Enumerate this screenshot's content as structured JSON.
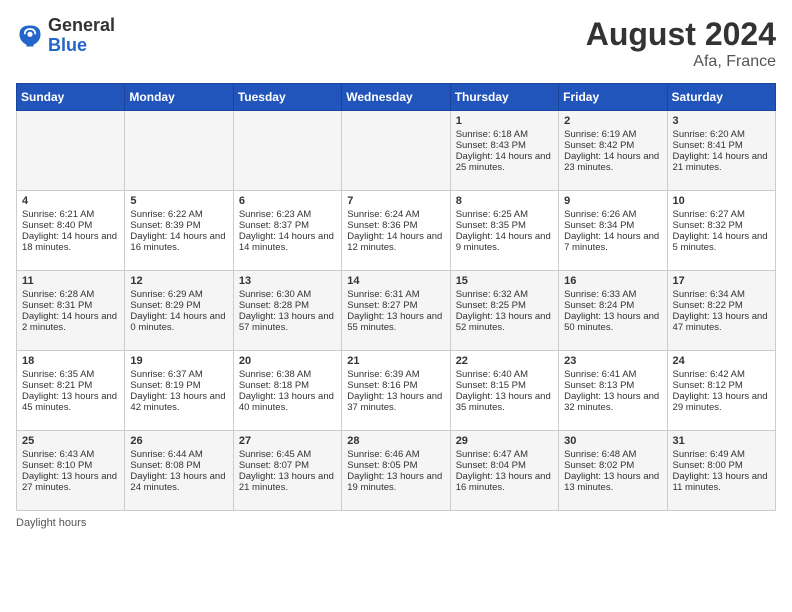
{
  "logo": {
    "general": "General",
    "blue": "Blue"
  },
  "title": "August 2024",
  "location": "Afa, France",
  "days_header": [
    "Sunday",
    "Monday",
    "Tuesday",
    "Wednesday",
    "Thursday",
    "Friday",
    "Saturday"
  ],
  "weeks": [
    [
      {
        "day": "",
        "info": ""
      },
      {
        "day": "",
        "info": ""
      },
      {
        "day": "",
        "info": ""
      },
      {
        "day": "",
        "info": ""
      },
      {
        "day": "1",
        "info": "Sunrise: 6:18 AM\nSunset: 8:43 PM\nDaylight: 14 hours and 25 minutes."
      },
      {
        "day": "2",
        "info": "Sunrise: 6:19 AM\nSunset: 8:42 PM\nDaylight: 14 hours and 23 minutes."
      },
      {
        "day": "3",
        "info": "Sunrise: 6:20 AM\nSunset: 8:41 PM\nDaylight: 14 hours and 21 minutes."
      }
    ],
    [
      {
        "day": "4",
        "info": "Sunrise: 6:21 AM\nSunset: 8:40 PM\nDaylight: 14 hours and 18 minutes."
      },
      {
        "day": "5",
        "info": "Sunrise: 6:22 AM\nSunset: 8:39 PM\nDaylight: 14 hours and 16 minutes."
      },
      {
        "day": "6",
        "info": "Sunrise: 6:23 AM\nSunset: 8:37 PM\nDaylight: 14 hours and 14 minutes."
      },
      {
        "day": "7",
        "info": "Sunrise: 6:24 AM\nSunset: 8:36 PM\nDaylight: 14 hours and 12 minutes."
      },
      {
        "day": "8",
        "info": "Sunrise: 6:25 AM\nSunset: 8:35 PM\nDaylight: 14 hours and 9 minutes."
      },
      {
        "day": "9",
        "info": "Sunrise: 6:26 AM\nSunset: 8:34 PM\nDaylight: 14 hours and 7 minutes."
      },
      {
        "day": "10",
        "info": "Sunrise: 6:27 AM\nSunset: 8:32 PM\nDaylight: 14 hours and 5 minutes."
      }
    ],
    [
      {
        "day": "11",
        "info": "Sunrise: 6:28 AM\nSunset: 8:31 PM\nDaylight: 14 hours and 2 minutes."
      },
      {
        "day": "12",
        "info": "Sunrise: 6:29 AM\nSunset: 8:29 PM\nDaylight: 14 hours and 0 minutes."
      },
      {
        "day": "13",
        "info": "Sunrise: 6:30 AM\nSunset: 8:28 PM\nDaylight: 13 hours and 57 minutes."
      },
      {
        "day": "14",
        "info": "Sunrise: 6:31 AM\nSunset: 8:27 PM\nDaylight: 13 hours and 55 minutes."
      },
      {
        "day": "15",
        "info": "Sunrise: 6:32 AM\nSunset: 8:25 PM\nDaylight: 13 hours and 52 minutes."
      },
      {
        "day": "16",
        "info": "Sunrise: 6:33 AM\nSunset: 8:24 PM\nDaylight: 13 hours and 50 minutes."
      },
      {
        "day": "17",
        "info": "Sunrise: 6:34 AM\nSunset: 8:22 PM\nDaylight: 13 hours and 47 minutes."
      }
    ],
    [
      {
        "day": "18",
        "info": "Sunrise: 6:35 AM\nSunset: 8:21 PM\nDaylight: 13 hours and 45 minutes."
      },
      {
        "day": "19",
        "info": "Sunrise: 6:37 AM\nSunset: 8:19 PM\nDaylight: 13 hours and 42 minutes."
      },
      {
        "day": "20",
        "info": "Sunrise: 6:38 AM\nSunset: 8:18 PM\nDaylight: 13 hours and 40 minutes."
      },
      {
        "day": "21",
        "info": "Sunrise: 6:39 AM\nSunset: 8:16 PM\nDaylight: 13 hours and 37 minutes."
      },
      {
        "day": "22",
        "info": "Sunrise: 6:40 AM\nSunset: 8:15 PM\nDaylight: 13 hours and 35 minutes."
      },
      {
        "day": "23",
        "info": "Sunrise: 6:41 AM\nSunset: 8:13 PM\nDaylight: 13 hours and 32 minutes."
      },
      {
        "day": "24",
        "info": "Sunrise: 6:42 AM\nSunset: 8:12 PM\nDaylight: 13 hours and 29 minutes."
      }
    ],
    [
      {
        "day": "25",
        "info": "Sunrise: 6:43 AM\nSunset: 8:10 PM\nDaylight: 13 hours and 27 minutes."
      },
      {
        "day": "26",
        "info": "Sunrise: 6:44 AM\nSunset: 8:08 PM\nDaylight: 13 hours and 24 minutes."
      },
      {
        "day": "27",
        "info": "Sunrise: 6:45 AM\nSunset: 8:07 PM\nDaylight: 13 hours and 21 minutes."
      },
      {
        "day": "28",
        "info": "Sunrise: 6:46 AM\nSunset: 8:05 PM\nDaylight: 13 hours and 19 minutes."
      },
      {
        "day": "29",
        "info": "Sunrise: 6:47 AM\nSunset: 8:04 PM\nDaylight: 13 hours and 16 minutes."
      },
      {
        "day": "30",
        "info": "Sunrise: 6:48 AM\nSunset: 8:02 PM\nDaylight: 13 hours and 13 minutes."
      },
      {
        "day": "31",
        "info": "Sunrise: 6:49 AM\nSunset: 8:00 PM\nDaylight: 13 hours and 11 minutes."
      }
    ]
  ],
  "footer": "Daylight hours"
}
